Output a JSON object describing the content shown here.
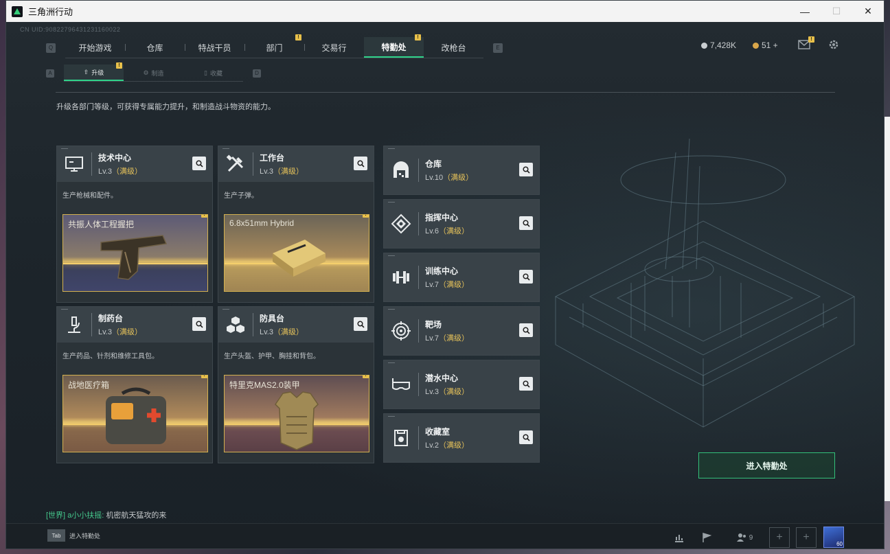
{
  "window": {
    "title": "三角洲行动",
    "controls": [
      "—",
      "☐",
      "✕"
    ]
  },
  "uid": "CN UID:9082279643123116002​2",
  "nav": {
    "left_key": "Q",
    "right_key": "E",
    "tabs": [
      {
        "label": "开始游戏",
        "badge": ""
      },
      {
        "label": "仓库",
        "badge": ""
      },
      {
        "label": "特战干员",
        "badge": ""
      },
      {
        "label": "部门",
        "badge": "!"
      },
      {
        "label": "交易行",
        "badge": ""
      },
      {
        "label": "特勤处",
        "badge": "!"
      },
      {
        "label": "改枪台",
        "badge": ""
      }
    ]
  },
  "currency": {
    "coins": "7,428K",
    "tickets": "51 +"
  },
  "subnav": {
    "left_key": "A",
    "right_key": "D",
    "tabs": [
      {
        "label": "升级",
        "badge": "!"
      },
      {
        "label": "制造",
        "badge": ""
      },
      {
        "label": "收藏",
        "badge": ""
      }
    ]
  },
  "description": "升级各部门等级，可获得专属能力提升，和制造战斗物资的能力。",
  "big_cards": [
    {
      "name": "技术中心",
      "level": "Lv.3",
      "status": "（满级）",
      "desc": "生产枪械和配件。",
      "product": "共振人体工程握把",
      "icon": "monitor-icon"
    },
    {
      "name": "工作台",
      "level": "Lv.3",
      "status": "（满级）",
      "desc": "生产子弹。",
      "product": "6.8x51mm Hybrid",
      "icon": "tools-icon"
    },
    {
      "name": "制药台",
      "level": "Lv.3",
      "status": "（满级）",
      "desc": "生产药品、针剂和维修工具包。",
      "product": "战地医疗箱",
      "icon": "microscope-icon"
    },
    {
      "name": "防具台",
      "level": "Lv.3",
      "status": "（满级）",
      "desc": "生产头盔、护甲、胸挂和背包。",
      "product": "特里克MAS2.0装甲",
      "icon": "cubes-icon"
    }
  ],
  "small_cards": [
    {
      "name": "仓库",
      "level": "Lv.10",
      "status": "（满级）",
      "icon": "warehouse-icon"
    },
    {
      "name": "指挥中心",
      "level": "Lv.6",
      "status": "（满级）",
      "icon": "command-icon"
    },
    {
      "name": "训练中心",
      "level": "Lv.7",
      "status": "（满级）",
      "icon": "dumbbell-icon"
    },
    {
      "name": "靶场",
      "level": "Lv.7",
      "status": "（满级）",
      "icon": "target-icon"
    },
    {
      "name": "潜水中心",
      "level": "Lv.3",
      "status": "（满级）",
      "icon": "goggles-icon"
    },
    {
      "name": "收藏室",
      "level": "Lv.2",
      "status": "（满级）",
      "icon": "collection-icon"
    }
  ],
  "enter_button": "进入特勤处",
  "chat": {
    "channel": "[世界]",
    "user": "a小小扶摇:",
    "message": "机密航天猛攻的来"
  },
  "bottom": {
    "tab_key": "Tab",
    "tab_label": "进入特勤处",
    "friends_count": "9",
    "avatar_level": "60"
  },
  "colors": {
    "accent": "#2fd38a",
    "max_level": "#e7c35a",
    "badge": "#e8c04a"
  }
}
